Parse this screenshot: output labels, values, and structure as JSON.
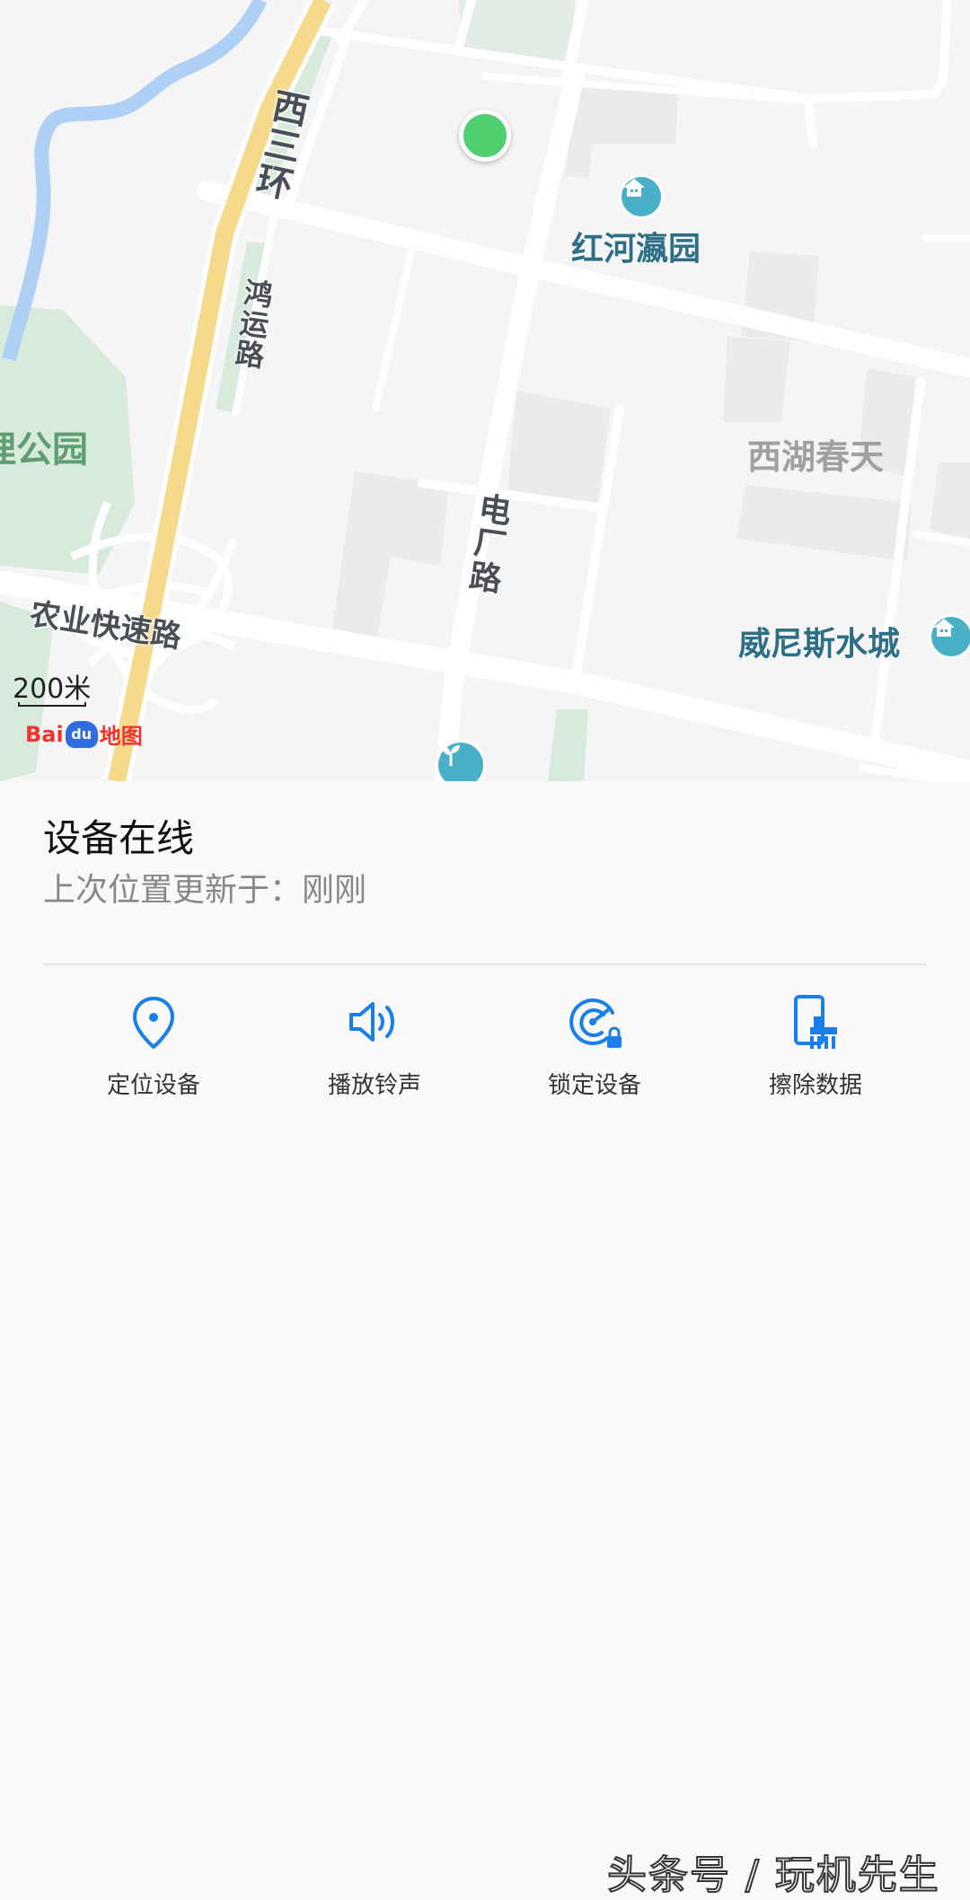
{
  "map": {
    "roads": {
      "west_third_ring": "西三环",
      "hongyun_road": "鸿运路",
      "dianchang_road": "电厂路",
      "agriculture_expressway": "农业快速路"
    },
    "pois": {
      "honghe_yingyuan": "红河瀛园",
      "venice_water_city": "威尼斯水城"
    },
    "areas": {
      "xihu_chuntian": "西湖春天",
      "park_fragment": "理公园"
    },
    "scale_label": "200米",
    "logo": "Bai地图",
    "colors": {
      "device_dot": "#4fcf70",
      "poi_icon": "#4ab0c8",
      "ring_road": "#f7d98b",
      "river": "#aed0f5",
      "park": "#cfe6d4"
    }
  },
  "status": {
    "title": "设备在线",
    "subtitle": "上次位置更新于：刚刚"
  },
  "actions": [
    {
      "label": "定位设备",
      "icon": "location-pin-icon"
    },
    {
      "label": "播放铃声",
      "icon": "speaker-icon"
    },
    {
      "label": "锁定设备",
      "icon": "lock-radar-icon"
    },
    {
      "label": "擦除数据",
      "icon": "erase-phone-icon"
    }
  ],
  "watermark": "头条号 / 玩机先生",
  "accent_color": "#1a7fe8"
}
